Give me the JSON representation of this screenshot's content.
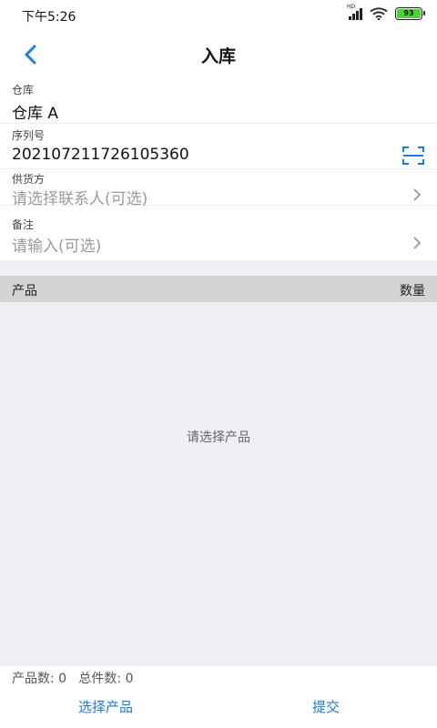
{
  "status_bar": {
    "time": "下午5:26",
    "battery": "93",
    "signal_tag": "HD"
  },
  "nav": {
    "title": "入库",
    "back_icon": "chevron-left-icon"
  },
  "form": {
    "warehouse": {
      "label": "仓库",
      "value": "仓库 A"
    },
    "serial": {
      "label": "序列号",
      "value": "202107211726105360",
      "icon": "scan-icon"
    },
    "supplier": {
      "label": "供货方",
      "placeholder": "请选择联系人(可选)"
    },
    "remark": {
      "label": "备注",
      "placeholder": "请输入(可选)"
    }
  },
  "product_list": {
    "columns": [
      "产品",
      "数量"
    ],
    "empty_text": "请选择产品"
  },
  "summary": {
    "text": "产品数: 0   总件数: 0"
  },
  "actions": {
    "select_label": "选择产品",
    "submit_label": "提交"
  },
  "colors": {
    "accent": "#1e7be0",
    "header_bg": "#d3d3d3",
    "list_bg": "#efeef3"
  }
}
